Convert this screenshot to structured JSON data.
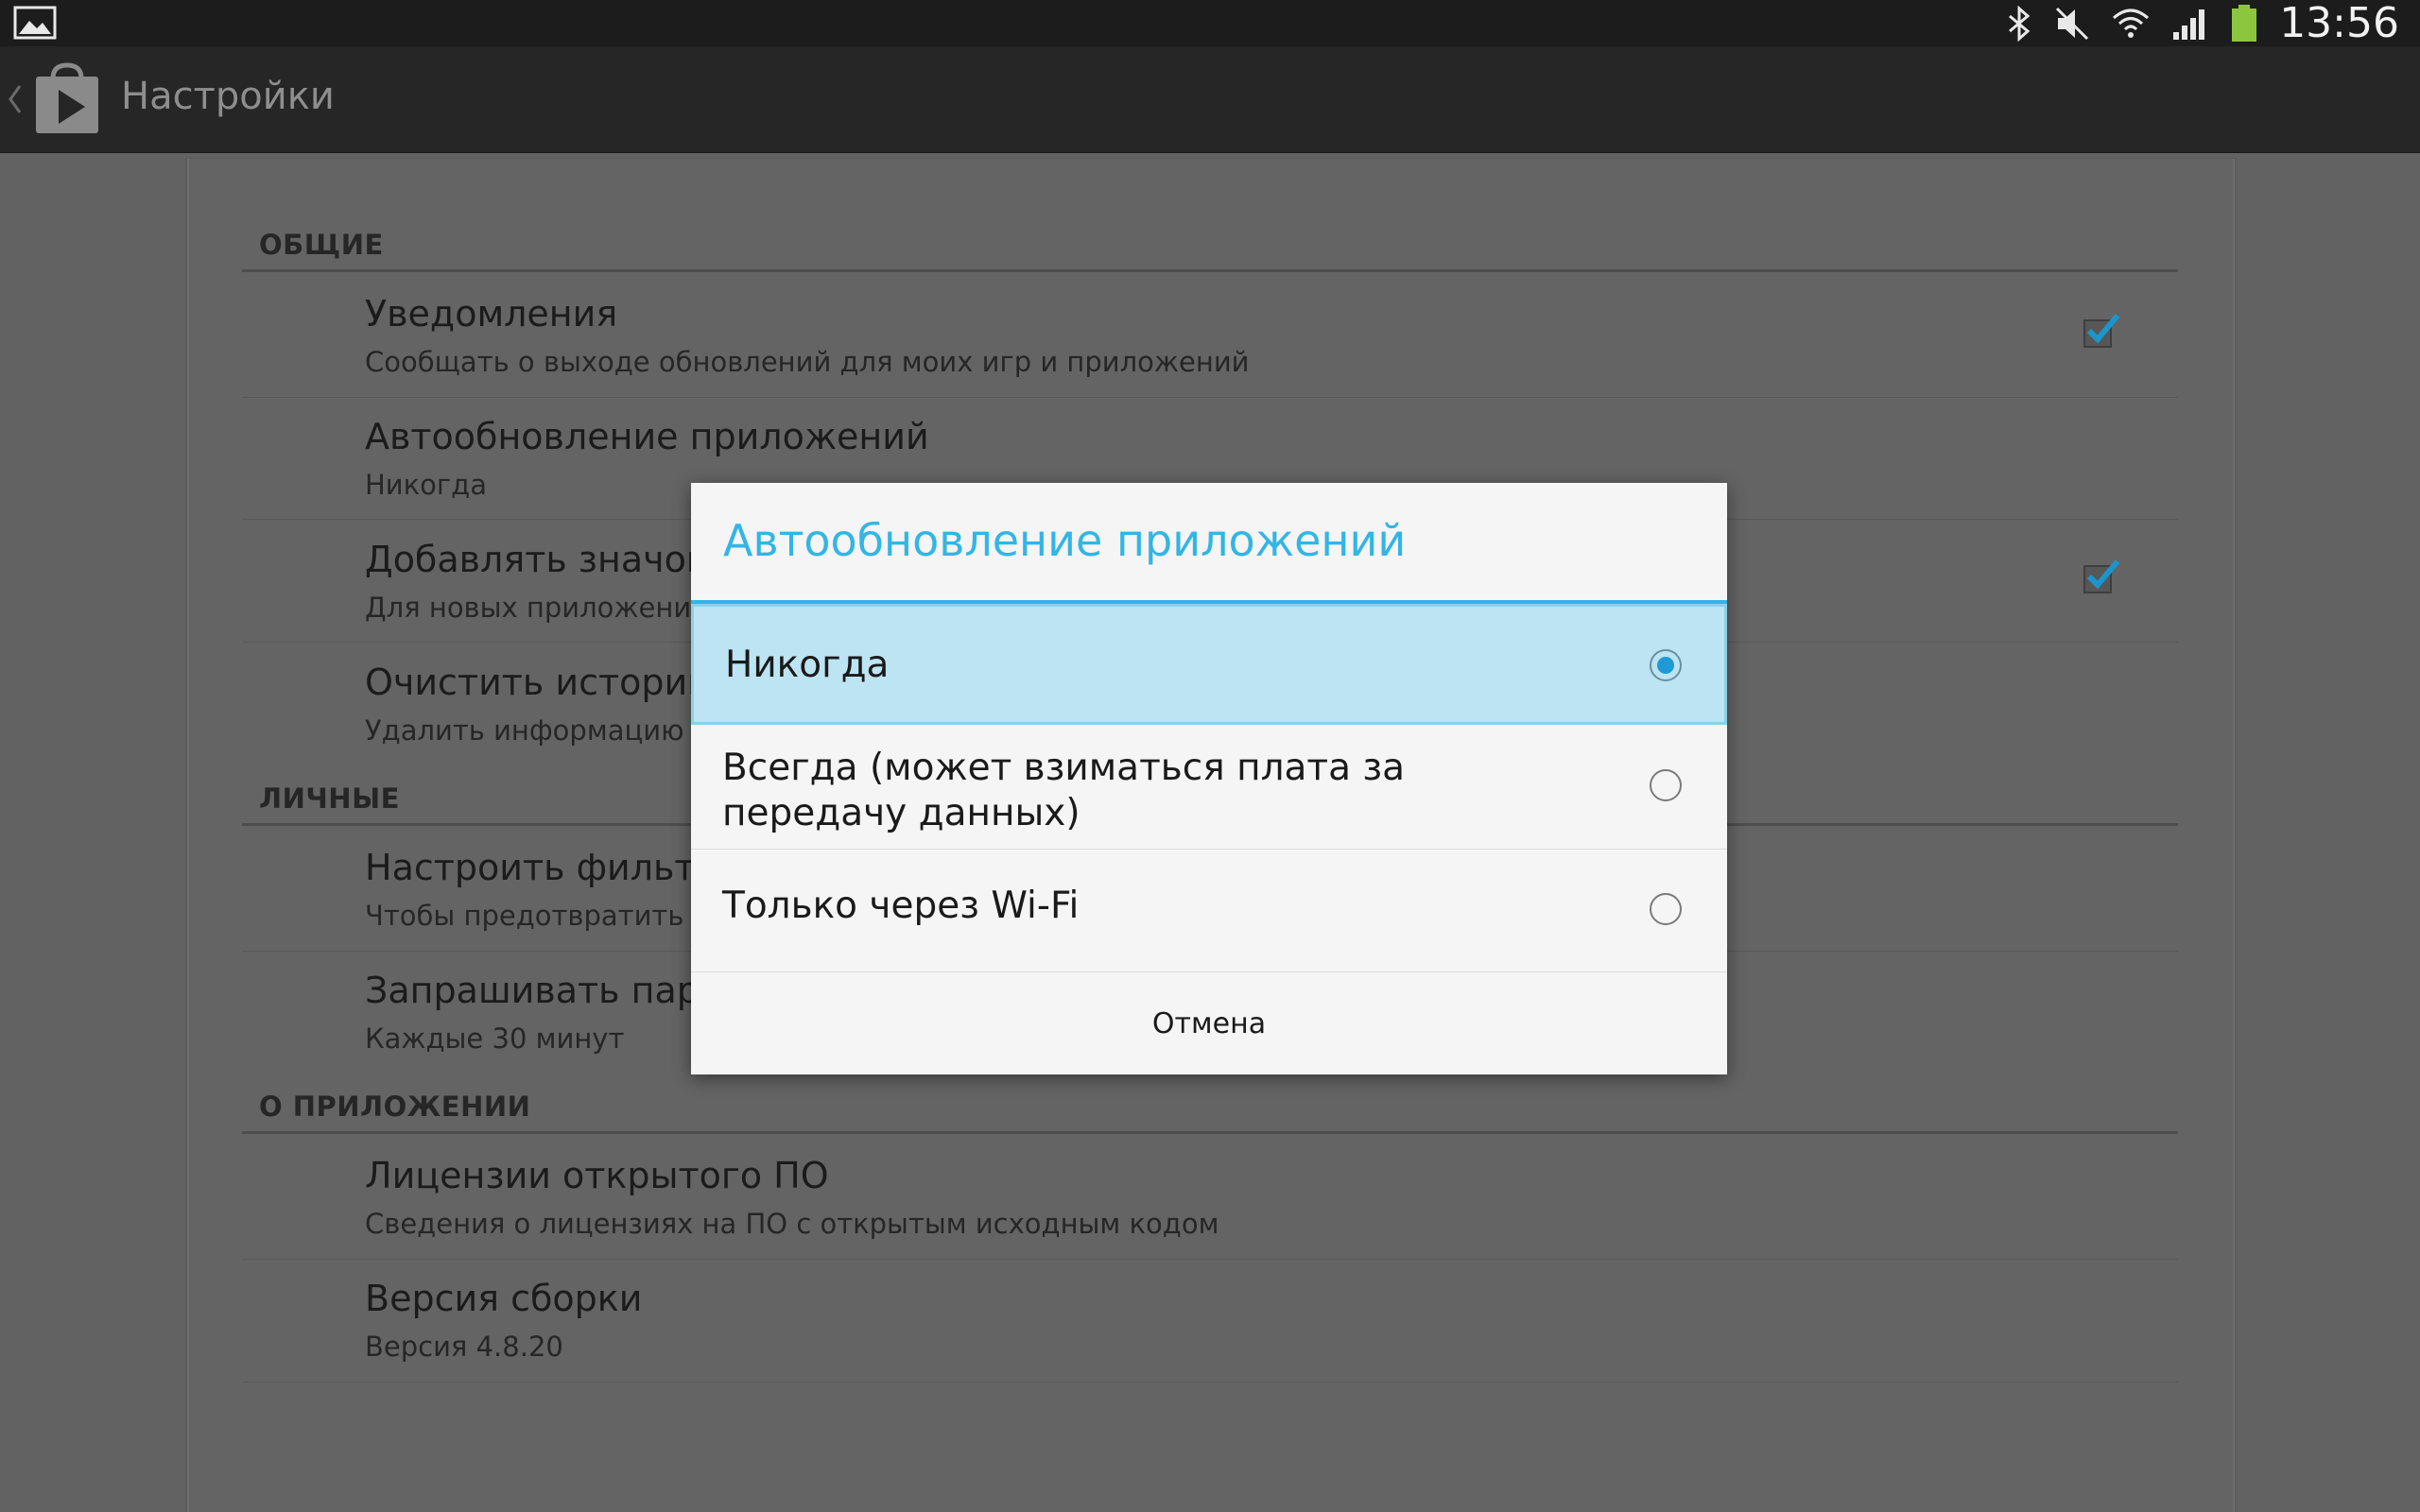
{
  "status_bar": {
    "time": "13:56",
    "icons": [
      "gallery-icon",
      "bluetooth-icon",
      "mute-icon",
      "wifi-icon",
      "signal-icon",
      "battery-icon"
    ],
    "battery_color": "#8cc63f"
  },
  "action_bar": {
    "title": "Настройки",
    "app_icon": "play-store-icon"
  },
  "settings": {
    "general": {
      "header": "ОБЩИЕ",
      "notifications": {
        "title": "Уведомления",
        "summary": "Сообщать о выходе обновлений для моих игр и приложений",
        "checked": true
      },
      "auto_update": {
        "title": "Автообновление приложений",
        "summary": "Никогда"
      },
      "add_icon": {
        "title": "Добавлять значок",
        "summary": "Для новых приложени",
        "checked": true
      },
      "clear_history": {
        "title": "Очистить историк",
        "summary": "Удалить информацию с"
      }
    },
    "personal": {
      "header": "ЛИЧНЫЕ",
      "content_filter": {
        "title": "Настроить фильтр",
        "summary": "Чтобы предотвратить з"
      },
      "require_password": {
        "title": "Запрашивать парс",
        "summary": "Каждые 30 минут"
      }
    },
    "about": {
      "header": "О ПРИЛОЖЕНИИ",
      "licenses": {
        "title": "Лицензии открытого ПО",
        "summary": "Сведения о лицензиях на ПО с открытым исходным кодом"
      },
      "build_version": {
        "title": "Версия сборки",
        "summary": "Версия 4.8.20"
      }
    }
  },
  "dialog": {
    "title": "Автообновление приложений",
    "accent_color": "#33b5e5",
    "options": [
      {
        "label": "Никогда",
        "selected": true
      },
      {
        "label": "Всегда (может взиматься плата за передачу данных)",
        "selected": false
      },
      {
        "label": "Только через Wi-Fi",
        "selected": false
      }
    ],
    "cancel_label": "Отмена"
  }
}
